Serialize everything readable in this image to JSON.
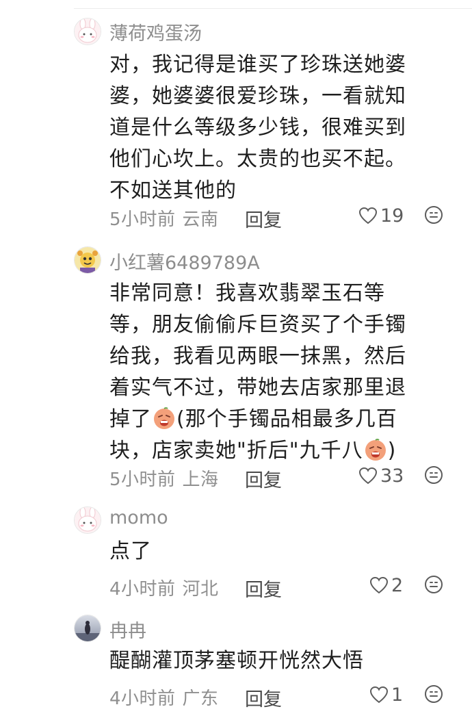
{
  "comments": [
    {
      "username": "薄荷鸡蛋汤",
      "avatar_icon": "bunny-avatar-icon",
      "lines": [
        "对，我记得是谁买了珍珠送她婆",
        "婆，她婆婆很爱珍珠，一看就知",
        "道是什么等级多少钱，很难买到",
        "他们心坎上。太贵的也买不起。",
        "不如送其他的"
      ],
      "time": "5小时前",
      "location": "云南",
      "reply_label": "回复",
      "likes": "19"
    },
    {
      "username": "小红薯6489789A",
      "avatar_icon": "cartoon-character-avatar-icon",
      "lines": [
        "非常同意！我喜欢翡翠玉石等",
        "等，朋友偷偷斥巨资买了个手镯",
        "给我，我看见两眼一抹黑，然后",
        "着实气不过，带她去店家那里退"
      ],
      "line5a": "掉了",
      "line5b": "(那个手镯品相最多几百",
      "line6a": "块，店家卖她\"折后\"九千八",
      "line6b": ")",
      "emoji_icon": "crying-face-emoji-icon",
      "time": "5小时前",
      "location": "上海",
      "reply_label": "回复",
      "likes": "33"
    },
    {
      "username": "momo",
      "avatar_icon": "bunny-avatar-icon",
      "lines": [
        "点了"
      ],
      "time": "4小时前",
      "location": "河北",
      "reply_label": "回复",
      "likes": "2"
    },
    {
      "username": "冉冉",
      "avatar_icon": "photo-avatar-icon",
      "lines": [
        "醍醐灌顶茅塞顿开恍然大悟"
      ],
      "time": "4小时前",
      "location": "广东",
      "reply_label": "回复",
      "likes": "1"
    }
  ],
  "icons": {
    "like": "heart-outline-icon",
    "reaction": "smiley-face-icon"
  },
  "colors": {
    "username": "#8d8d8d",
    "body_text": "#1e1e1e",
    "meta_text": "#8f8f8f",
    "emoji_face": "#f3a07a"
  }
}
